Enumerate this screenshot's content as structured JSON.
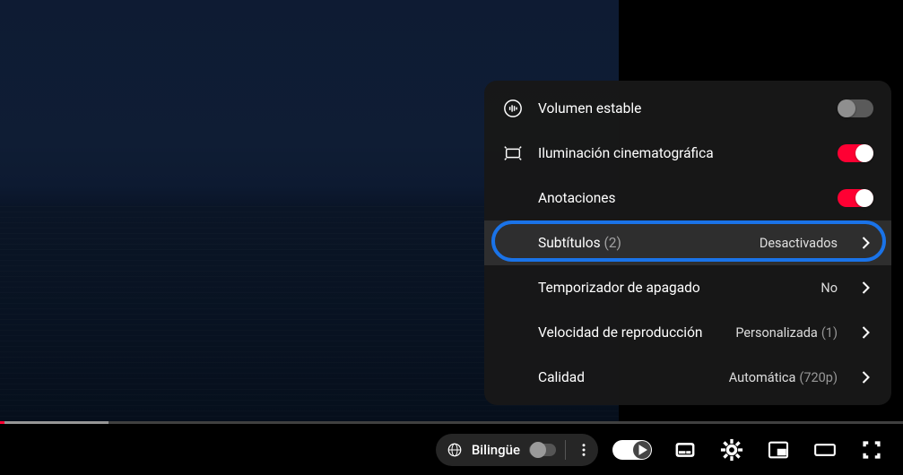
{
  "progress": {
    "buffer_pct": 12,
    "played_pct": 0.5
  },
  "bilingual": {
    "label": "Bilingüe",
    "on": false
  },
  "autoplay": {
    "on": true
  },
  "settings": {
    "stable_volume": {
      "label": "Volumen estable",
      "on": false
    },
    "ambient": {
      "label": "Iluminación cinematográfica",
      "on": true
    },
    "annotations": {
      "label": "Anotaciones",
      "on": true
    },
    "subtitles": {
      "label": "Subtítulos",
      "count": "(2)",
      "value": "Desactivados"
    },
    "sleep_timer": {
      "label": "Temporizador de apagado",
      "value": "No"
    },
    "speed": {
      "label": "Velocidad de reproducción",
      "value": "Personalizada",
      "value_detail": "(1)"
    },
    "quality": {
      "label": "Calidad",
      "value": "Automática",
      "value_detail": "(720p)"
    }
  },
  "highlighted_row": "subtitles"
}
